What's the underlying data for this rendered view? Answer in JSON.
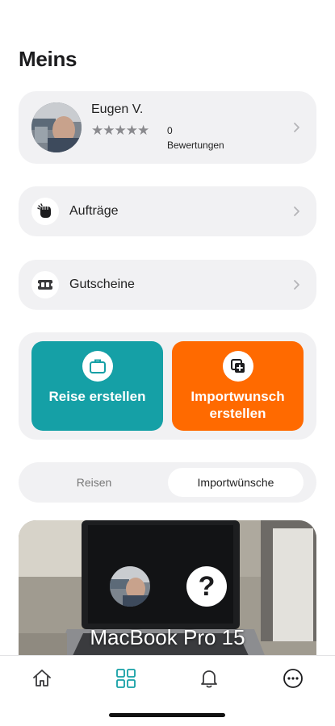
{
  "header": {
    "title": "Meins"
  },
  "profile": {
    "name": "Eugen V.",
    "stars": "★★★★★",
    "rating_count": "0",
    "rating_label": "Bewertungen"
  },
  "menu": {
    "orders": {
      "label": "Aufträge",
      "icon": "fist-icon"
    },
    "vouchers": {
      "label": "Gutscheine",
      "icon": "voucher-icon"
    }
  },
  "actions": {
    "trip": {
      "label": "Reise erstellen",
      "color": "#15a0a6",
      "icon": "suitcase-icon"
    },
    "import": {
      "label": "Importwunsch erstellen",
      "color": "#ff6a00",
      "icon": "import-add-icon"
    }
  },
  "segments": {
    "trips": "Reisen",
    "imports": "Importwünsche",
    "selected": "Importwünsche"
  },
  "listing": {
    "title": "MacBook Pro 15",
    "badge": "?"
  },
  "tabbar": {
    "active": "grid",
    "accent": "#15a0a6",
    "icons": [
      "home-icon",
      "grid-icon",
      "bell-icon",
      "more-icon"
    ]
  }
}
